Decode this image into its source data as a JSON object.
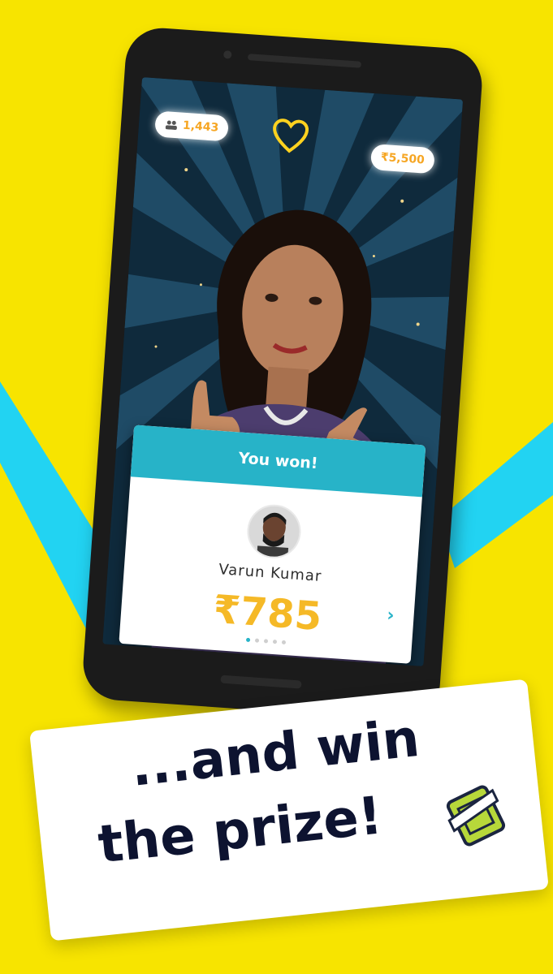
{
  "header": {
    "viewer_count": "1,443",
    "prize_pool": "₹5,500"
  },
  "winner_card": {
    "title": "You won!",
    "winner_name": "Varun Kumar",
    "amount": "₹785",
    "page_count": 5,
    "active_page": 0
  },
  "caption": {
    "line1": "...and win",
    "line2": "the prize!"
  },
  "icons": {
    "viewers": "viewers-icon",
    "heart": "heart-icon",
    "next": "chevron-right-icon",
    "ticket": "ticket-icon"
  },
  "colors": {
    "background": "#f7e400",
    "accent_cyan": "#27b3c8",
    "prize_gold": "#f5b927",
    "caption_text": "#0d1330"
  }
}
